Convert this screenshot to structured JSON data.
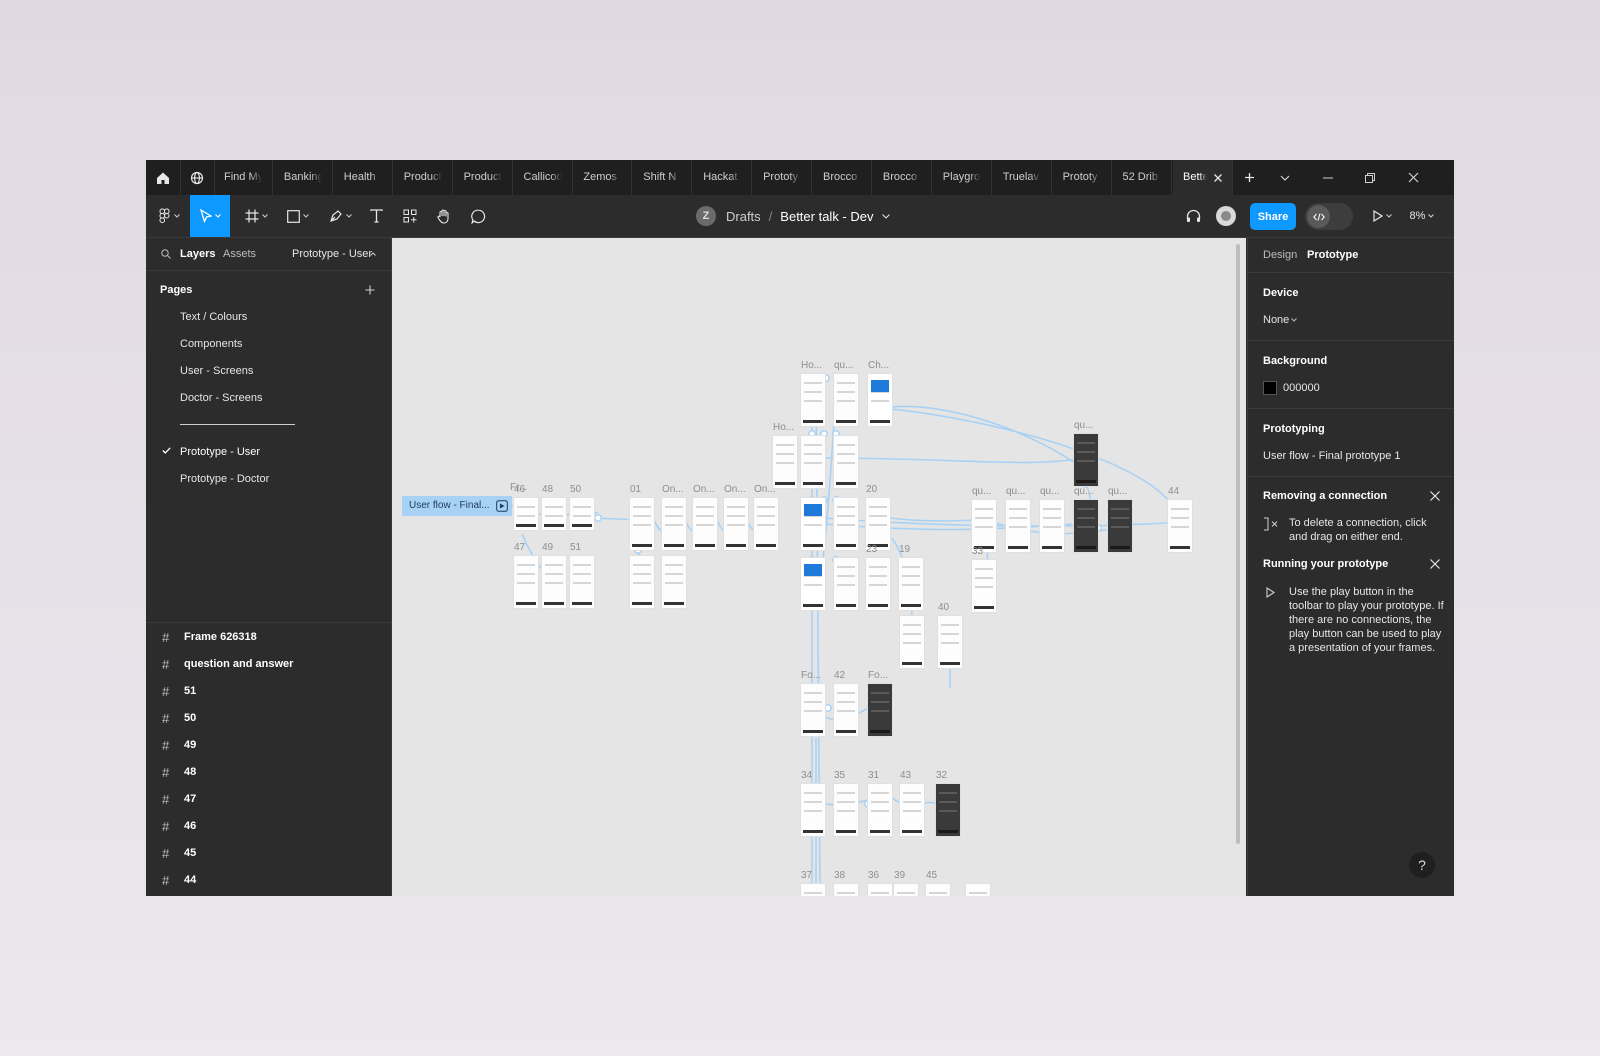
{
  "tabs": [
    "Find My",
    "Banking",
    "Health",
    "Product",
    "Product",
    "Callicoo",
    "Zemos",
    "Shift N",
    "Hackat",
    "Prototy",
    "Brocco",
    "Brocco",
    "Playgro",
    "Truelav",
    "Prototy",
    "52 Drib"
  ],
  "active_tab": "Bette",
  "file": {
    "avatar_initial": "Z",
    "location": "Drafts",
    "separator": "/",
    "name": "Better talk - Dev"
  },
  "toolbar": {
    "share_label": "Share",
    "zoom": "8%"
  },
  "left_panel": {
    "tab_layers": "Layers",
    "tab_assets": "Assets",
    "current_page": "Prototype - User",
    "pages_title": "Pages",
    "pages": [
      "Text / Colours",
      "Components",
      "User - Screens",
      "Doctor - Screens"
    ],
    "pages_bottom": [
      "Prototype - User",
      "Prototype - Doctor"
    ],
    "layers": [
      "Frame 626318",
      "question and answer",
      "51",
      "50",
      "49",
      "48",
      "47",
      "46",
      "45",
      "44"
    ]
  },
  "canvas": {
    "flow_label": "User flow - Final...",
    "frame_labels": [
      "Fr...",
      "46",
      "48",
      "50",
      "47",
      "49",
      "51",
      "01",
      "On...",
      "On...",
      "On...",
      "On...",
      "Ho...",
      "qu...",
      "Ch...",
      "Ho...",
      "20",
      "23",
      "19",
      "40",
      "Fo...",
      "42",
      "Fo...",
      "qu...",
      "qu...",
      "qu...",
      "qu...",
      "qu...",
      "44",
      "qu...",
      "33",
      "34",
      "35",
      "31",
      "43",
      "32",
      "37",
      "38",
      "36",
      "39",
      "45"
    ]
  },
  "right_panel": {
    "tab_design": "Design",
    "tab_prototype": "Prototype",
    "device_title": "Device",
    "device_value": "None",
    "background_title": "Background",
    "background_value": "000000",
    "background_color": "#000000",
    "prototyping_title": "Prototyping",
    "flow_name": "User flow - Final prototype 1",
    "removing_title": "Removing a connection",
    "removing_text": "To delete a connection, click and drag on either end.",
    "running_title": "Running your prototype",
    "running_text": "Use the play button in the toolbar to play your prototype. If there are no connections, the play button can be used to play a presentation of your frames."
  },
  "help_label": "?",
  "colors": {
    "accent": "#0d99ff",
    "connector": "#a8d2f5"
  }
}
